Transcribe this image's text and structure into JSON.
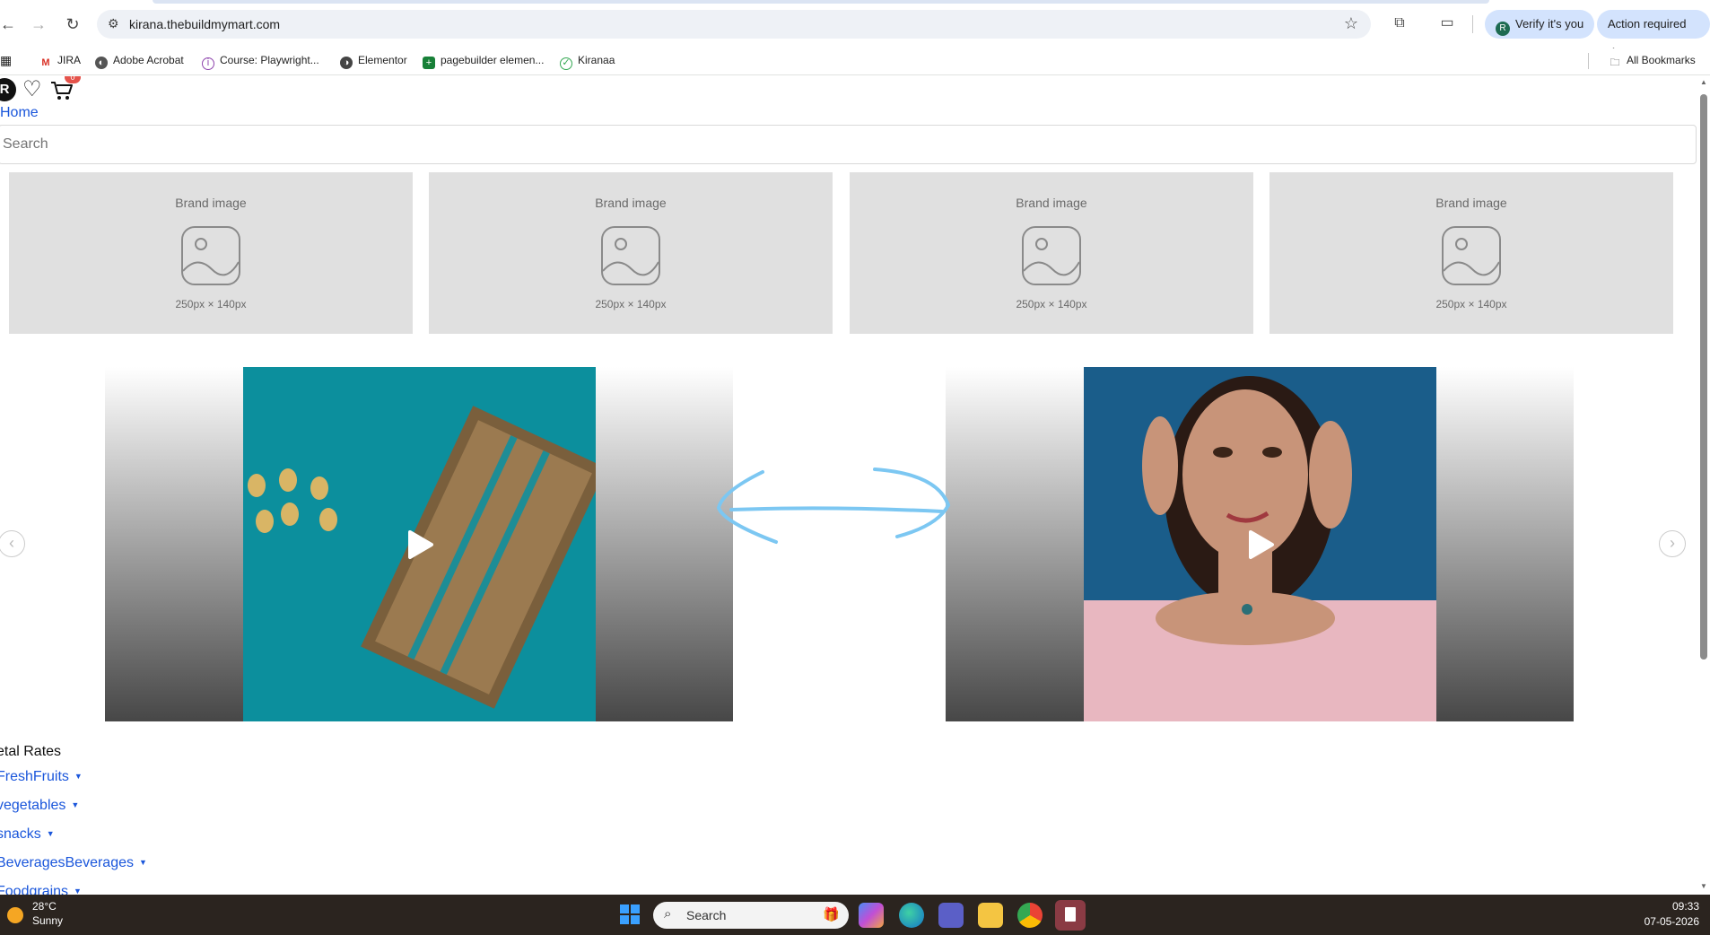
{
  "browser": {
    "url": "kirana.thebuildmymart.com",
    "verify_label": "Verify it's you",
    "verify_avatar": "R",
    "action_label": "Action required"
  },
  "bookmarks": [
    {
      "label": "JIRA",
      "icon": "gmail-icon"
    },
    {
      "label": "Adobe Acrobat",
      "icon": "acrobat-icon"
    },
    {
      "label": "Course: Playwright...",
      "icon": "course-icon"
    },
    {
      "label": "Elementor",
      "icon": "elementor-icon"
    },
    {
      "label": "pagebuilder elemen...",
      "icon": "sheets-icon"
    },
    {
      "label": "Kiranaa",
      "icon": "check-icon"
    }
  ],
  "all_bookmarks_label": "All Bookmarks",
  "site": {
    "avatar_letter": "R",
    "cart_count": "0",
    "home_link": "Home",
    "search_placeholder": "Search"
  },
  "brands": [
    {
      "title": "Brand image",
      "dims": "250px × 140px"
    },
    {
      "title": "Brand image",
      "dims": "250px × 140px"
    },
    {
      "title": "Brand image",
      "dims": "250px × 140px"
    },
    {
      "title": "Brand image",
      "dims": "250px × 140px"
    }
  ],
  "categories": {
    "title": "etal Rates",
    "items": [
      "FreshFruits",
      "vegetables",
      "snacks",
      "BeveragesBeverages",
      "Foodgrains"
    ]
  },
  "taskbar": {
    "temperature": "28°C",
    "weather": "Sunny",
    "search_label": "Search",
    "time": "09:33",
    "date": "07-05-2026"
  },
  "colors": {
    "link": "#1a56db",
    "placeholder_bg": "#e0e0e0",
    "badge": "#e5534b",
    "swipe_hint": "#7cc7f2"
  }
}
